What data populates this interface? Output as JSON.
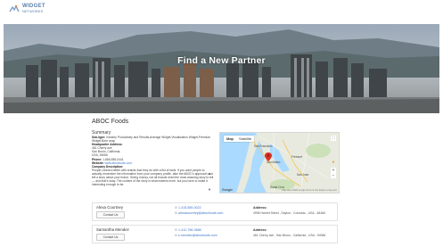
{
  "header": {
    "logo_line1": "WIDGET",
    "logo_line2": "NETWORKS",
    "logo_icon": "widget-logo-icon"
  },
  "hero": {
    "title": "Find a New Partner"
  },
  "company": {
    "name": "ABOC Foods",
    "summary_title": "Summary",
    "summary": [
      {
        "label": "Sub-type:",
        "text": "Industry Productivity and Results,Average Widget,Visualization Widget,Premium Widget,Bore wrap"
      },
      {
        "label": "Headquarter Address:",
        "text": ""
      },
      {
        "label": "",
        "text": "461 Cherry ave"
      },
      {
        "label": "",
        "text": "San Bruno, California,"
      },
      {
        "label": "",
        "text": "USA, 94066"
      },
      {
        "label": "Phone:",
        "text": "1-866-555-0441"
      },
      {
        "label": "Website:",
        "text": "www.abocfoods.com",
        "link": true
      },
      {
        "label": "Company Description:",
        "text": ""
      },
      {
        "label": "",
        "text": "People connect better with brands that they do with a fist of facts. If you want people to actually remember the information from your company profile, take the ABOC's approach and tell a story about your brand. Giving money, not all brands need the most amazing story to tell — and that's okay. The content of the story is what matters more, but you have to make it interesting enough to be."
      }
    ]
  },
  "map": {
    "tab_map": "Map",
    "tab_satellite": "Satellite",
    "google_label": "Google",
    "terms": "Map data ©2020 Google  Terms of Use  Report a map error",
    "zoom_in": "+",
    "zoom_out": "−",
    "city_labels": [
      "San Francisco",
      "San Mateo",
      "Fremont",
      "San Jose",
      "Santa Cruz"
    ]
  },
  "contacts": [
    {
      "name": "Alexa Courtney",
      "button": "Contact Us",
      "phone": "1-415-555-0022",
      "email": "alexacourtney@abocfoods.com",
      "address_label": "Address:",
      "address": "4996 Harriet Street , Dayton , Colorado , USA - 48466"
    },
    {
      "name": "Samantha Mendez",
      "button": "Contact Us",
      "phone": "1-412-756-3686",
      "email": "s.mendez@abocfoods.com",
      "address_label": "Address:",
      "address": "461 Cherry ave , San Bruno , California , USA - 94066"
    }
  ],
  "colors": {
    "link": "#3b74c9",
    "brand": "#5a7fa8",
    "map_pin": "#d93025"
  }
}
